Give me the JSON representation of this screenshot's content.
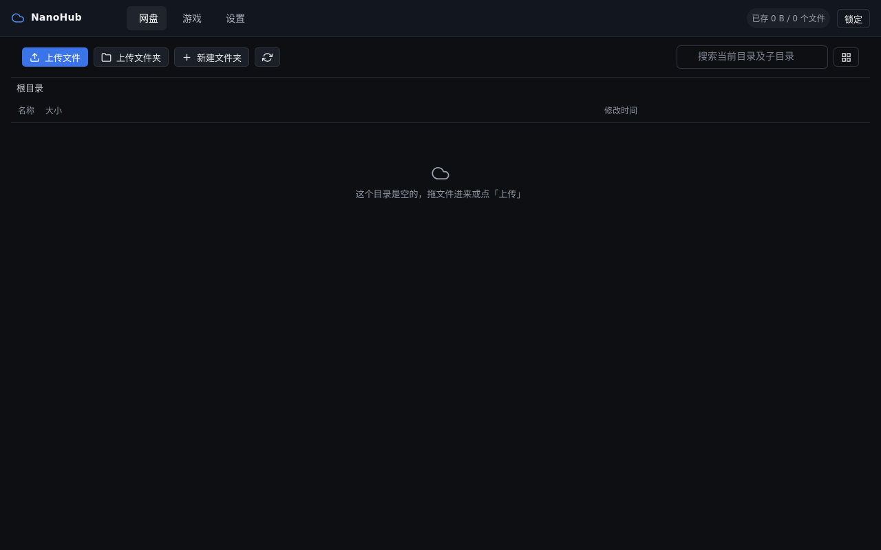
{
  "app": {
    "name": "NanoHub"
  },
  "nav": {
    "tabs": [
      {
        "label": "网盘",
        "active": true
      },
      {
        "label": "游戏"
      },
      {
        "label": "设置"
      }
    ]
  },
  "header": {
    "storage": "已存 0 B / 0 个文件",
    "lock_label": "锁定"
  },
  "toolbar": {
    "upload_file": "上传文件",
    "upload_folder": "上传文件夹",
    "new_folder": "新建文件夹",
    "search_placeholder": "搜索当前目录及子目录"
  },
  "breadcrumb": {
    "root": "根目录"
  },
  "table": {
    "columns": {
      "name": "名称",
      "size": "大小",
      "modified": "修改时间"
    }
  },
  "empty_state": {
    "message": "这个目录是空的，拖文件进来或点「上传」"
  },
  "colors": {
    "accent": "#3b73e8",
    "background": "#0d0f13",
    "header_bg": "#12161e"
  },
  "icons": {
    "brand": "cloud-icon",
    "upload": "upload-icon",
    "folder": "folder-icon",
    "plus": "plus-icon",
    "refresh": "refresh-icon",
    "grid": "grid-view-icon",
    "empty": "cloud-icon"
  }
}
